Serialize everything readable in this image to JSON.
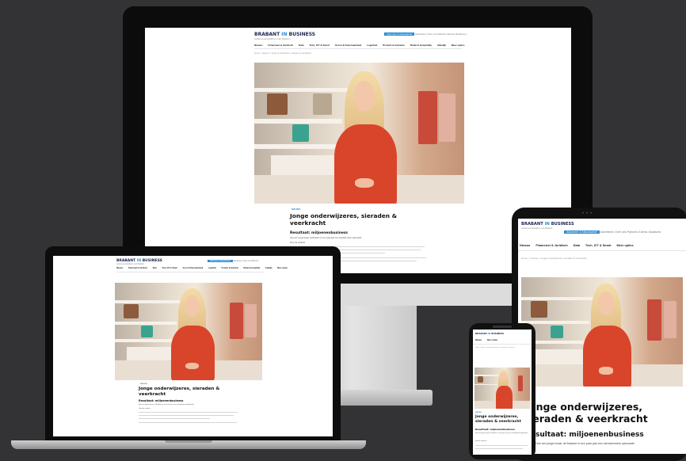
{
  "site": {
    "logo_main": "BRABANT",
    "logo_in": "IN",
    "logo_end": "BUSINESS",
    "tagline": "ondernemersplatform van Brabant",
    "subscribe_label": "Abonneer & Nieuwsbrief",
    "top_links": [
      "Adverteren",
      "Over ons",
      "Partners",
      "Events",
      "Vacatures"
    ],
    "nav": [
      "Nieuws",
      "Financieel & Juridisch",
      "Data",
      "Tech, ICT & Smart",
      "Groen & Duurzaamheid",
      "Logistiek",
      "Product & Industrie",
      "Retail & Hospitality",
      "Zakelijk",
      "Meer opties"
    ],
    "breadcrumb": "Home > Nieuws > Jonge onderwijzeres, sieraden & veerkracht",
    "category": "NIEUWS",
    "headline": "Jonge onderwijzeres, sieraden & veerkracht",
    "subheadline": "Resultaat: miljoenenbusiness",
    "intro": "Hoe een jonge leraar uit Brabant in een paar jaar een sieradenmerk opbouwde",
    "byline": "Door de redactie"
  },
  "tablet": {
    "headline_visible": "onge onderwijzeres, ieraden & veerkracht",
    "subheadline_visible": "sultaat: miljoenenbusiness"
  },
  "colors": {
    "background": "#333335",
    "brand_blue": "#2a8dd4",
    "brand_navy": "#1b2550",
    "dress_red": "#d9452a"
  }
}
